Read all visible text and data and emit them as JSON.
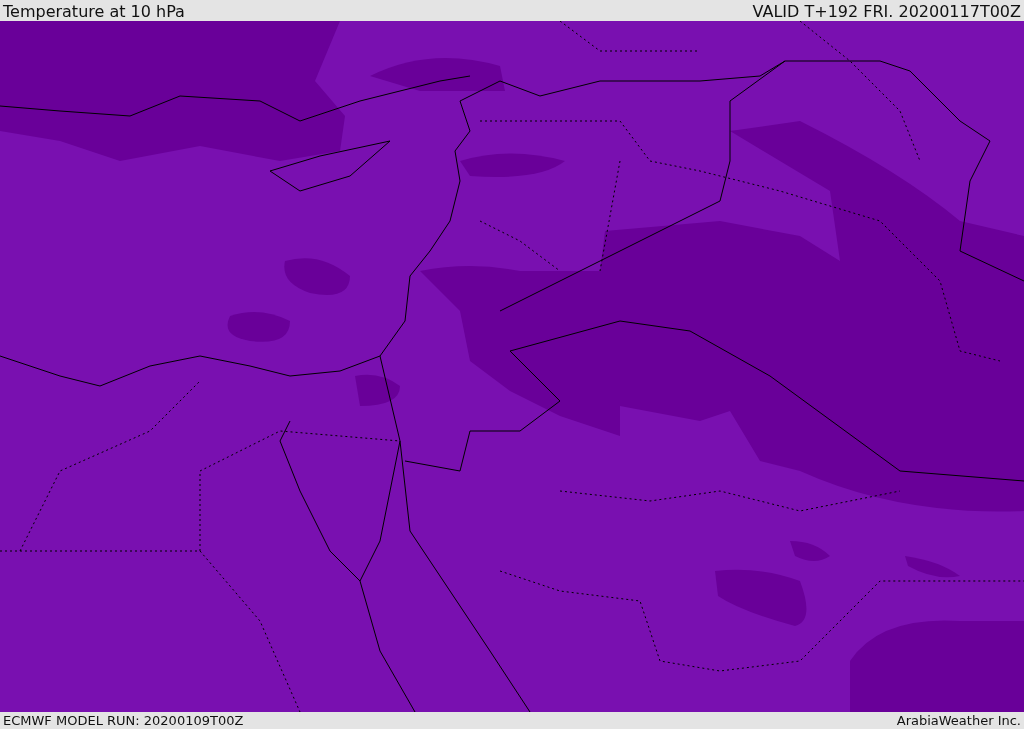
{
  "header": {
    "title": "Temperature at 10 hPa",
    "valid_time": "VALID T+192 FRI. 20200117T00Z"
  },
  "footer": {
    "model_run": "ECMWF MODEL RUN: 20200109T00Z",
    "credit": "ArabiaWeather Inc."
  }
}
